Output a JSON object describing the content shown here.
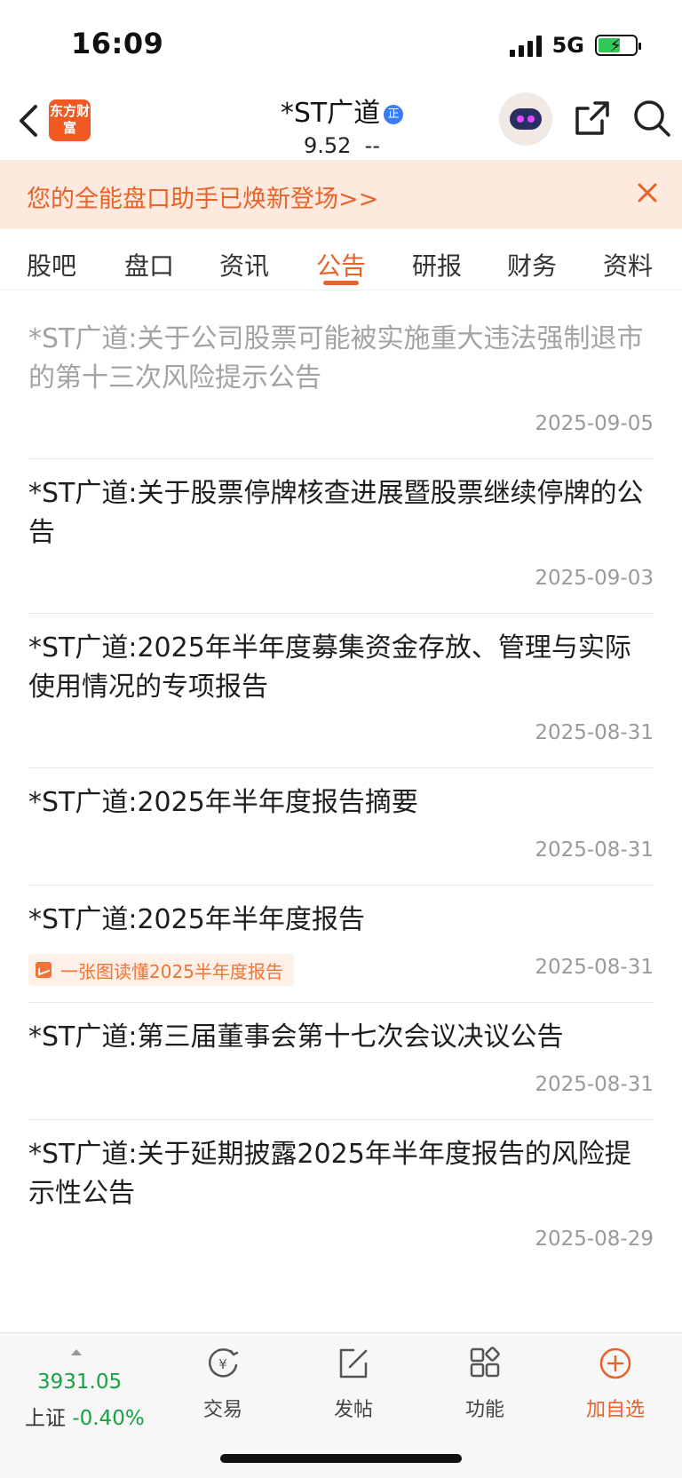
{
  "status_bar": {
    "time": "16:09",
    "network": "5G"
  },
  "header": {
    "logo_text": "东方财富",
    "stock_name": "*ST广道",
    "badge": "正",
    "price_line": "9.52  --"
  },
  "banner": {
    "text": "您的全能盘口助手已焕新登场>>"
  },
  "tabs": [
    {
      "label": "股吧"
    },
    {
      "label": "盘口"
    },
    {
      "label": "资讯"
    },
    {
      "label": "公告"
    },
    {
      "label": "研报"
    },
    {
      "label": "财务"
    },
    {
      "label": "资料"
    }
  ],
  "active_tab": "公告",
  "announcements": [
    {
      "title": "*ST广道:关于公司股票可能被实施重大违法强制退市的第十三次风险提示公告",
      "date": "2025-09-05",
      "read": true
    },
    {
      "title": "*ST广道:关于股票停牌核查进展暨股票继续停牌的公告",
      "date": "2025-09-03",
      "read": false
    },
    {
      "title": "*ST广道:2025年半年度募集资金存放、管理与实际使用情况的专项报告",
      "date": "2025-08-31",
      "read": false
    },
    {
      "title": "*ST广道:2025年半年度报告摘要",
      "date": "2025-08-31",
      "read": false
    },
    {
      "title": "*ST广道:2025年半年度报告",
      "date": "2025-08-31",
      "read": false,
      "tag": "一张图读懂2025半年度报告"
    },
    {
      "title": "*ST广道:第三届董事会第十七次会议决议公告",
      "date": "2025-08-31",
      "read": false
    },
    {
      "title": "*ST广道:关于延期披露2025年半年度报告的风险提示性公告",
      "date": "2025-08-29",
      "read": false
    }
  ],
  "bottom_bar": {
    "index_value": "3931.05",
    "index_name": "上证",
    "index_change": "-0.40%",
    "buttons": [
      {
        "label": "交易",
        "icon": "yen-circle-icon"
      },
      {
        "label": "发帖",
        "icon": "edit-icon"
      },
      {
        "label": "功能",
        "icon": "grid-icon"
      },
      {
        "label": "加自选",
        "icon": "plus-circle-icon"
      }
    ]
  },
  "colors": {
    "accent": "#e8632a",
    "index_green": "#1aa044",
    "banner_bg": "#fde9dd"
  }
}
